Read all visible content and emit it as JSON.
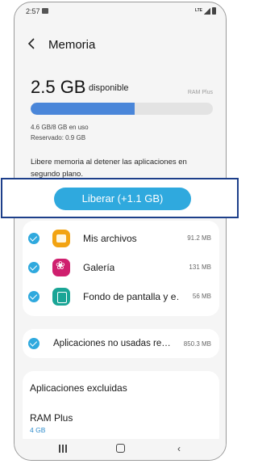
{
  "status_bar": {
    "time": "2:57",
    "network": "LTE"
  },
  "header": {
    "title": "Memoria"
  },
  "memory": {
    "available_value": "2.5 GB",
    "available_label": "disponible",
    "ram_plus_caption": "RAM Plus",
    "usage_fraction": 0.57,
    "used_text": "4.6 GB/8 GB en uso",
    "reserved_text": "Reservado: 0.9 GB",
    "description": "Libere memoria al detener las aplicaciones en segundo plano."
  },
  "free_button": {
    "label": "Liberar (+1.1 GB)"
  },
  "apps": [
    {
      "name": "Mis archivos",
      "size": "91.2 MB",
      "icon": "folder-icon",
      "checked": true
    },
    {
      "name": "Galería",
      "size": "131 MB",
      "icon": "gallery-icon",
      "checked": true
    },
    {
      "name": "Fondo de pantalla y e…",
      "size": "56 MB",
      "icon": "wallpaper-icon",
      "checked": true
    }
  ],
  "unused_apps": {
    "label": "Aplicaciones no usadas re…",
    "size": "850.3 MB",
    "checked": true
  },
  "excluded": {
    "label": "Aplicaciones excluidas"
  },
  "ram_plus": {
    "label": "RAM Plus",
    "value": "4 GB"
  },
  "colors": {
    "accent": "#2fa9de",
    "bar": "#4a86d9",
    "highlight_border": "#1d3f8a"
  }
}
